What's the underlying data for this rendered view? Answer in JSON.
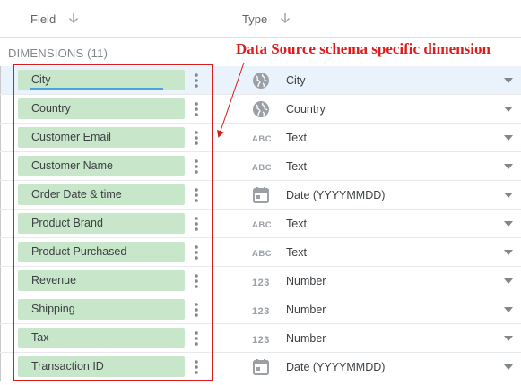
{
  "header": {
    "field_label": "Field",
    "type_label": "Type"
  },
  "section": {
    "label": "DIMENSIONS (11)"
  },
  "annotation": {
    "text": "Data Source schema specific dimension",
    "color": "#e01b1b"
  },
  "colors": {
    "chip_green": "#c8e6c9",
    "selected_row": "#eaf3fb",
    "icon_gray": "#9aa0a6",
    "highlight_border": "#d81b1b"
  },
  "rows": [
    {
      "field": "City",
      "type": "City",
      "type_icon": "globe-icon",
      "selected": true
    },
    {
      "field": "Country",
      "type": "Country",
      "type_icon": "globe-icon"
    },
    {
      "field": "Customer Email",
      "type": "Text",
      "type_icon": "abc-icon"
    },
    {
      "field": "Customer Name",
      "type": "Text",
      "type_icon": "abc-icon"
    },
    {
      "field": "Order Date & time",
      "type": "Date (YYYYMMDD)",
      "type_icon": "calendar-icon"
    },
    {
      "field": "Product Brand",
      "type": "Text",
      "type_icon": "abc-icon"
    },
    {
      "field": "Product Purchased",
      "type": "Text",
      "type_icon": "abc-icon"
    },
    {
      "field": "Revenue",
      "type": "Number",
      "type_icon": "number-icon"
    },
    {
      "field": "Shipping",
      "type": "Number",
      "type_icon": "number-icon"
    },
    {
      "field": "Tax",
      "type": "Number",
      "type_icon": "number-icon"
    },
    {
      "field": "Transaction ID",
      "type": "Date (YYYYMMDD)",
      "type_icon": "calendar-icon"
    }
  ]
}
